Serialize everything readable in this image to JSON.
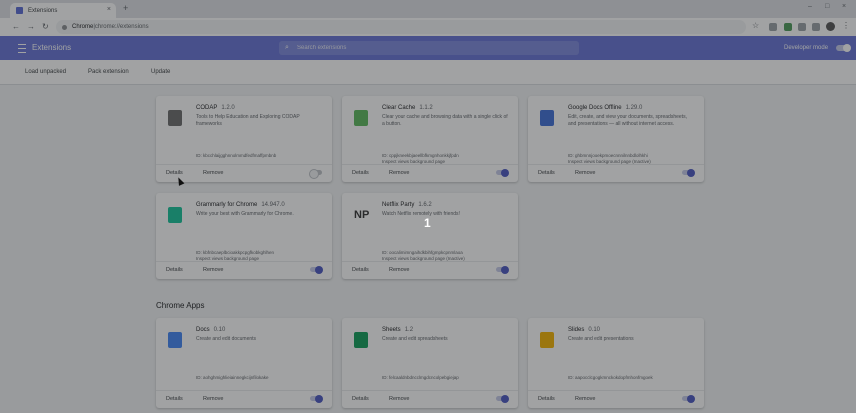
{
  "browser": {
    "tab_title": "Extensions",
    "tab_close": "×",
    "new_tab": "+",
    "window_controls": [
      "–",
      "□",
      "×"
    ],
    "address_chip": "Chrome",
    "address_sep": " | ",
    "address_url": "chrome://extensions"
  },
  "header": {
    "title": "Extensions",
    "search_placeholder": "Search extensions",
    "dev_mode_label": "Developer mode"
  },
  "subbar": {
    "load_unpacked": "Load unpacked",
    "pack_extension": "Pack extension",
    "update": "Update"
  },
  "extensions": [
    {
      "name": "CODAP",
      "version": "1.2.0",
      "description": "Tools to Help Education and Exploring CODAP frameworks",
      "id": "ID: kbcchlaijgghnnolmmdfedfmaffpmbnb",
      "details": "Details",
      "remove": "Remove",
      "enabled": false,
      "icon_color": "#6b6b6b"
    },
    {
      "name": "Clear Cache",
      "version": "1.1.2",
      "description": "Clear your cache and browsing data with a single click of a button.",
      "id": "ID: cppjkneekbjaeellbfkmgnhonkkjfpdn",
      "inspect": "Inspect views background page",
      "details": "Details",
      "remove": "Remove",
      "enabled": true,
      "icon_color": "#5cb85c"
    },
    {
      "name": "Google Docs Offline",
      "version": "1.29.0",
      "description": "Edit, create, and view your documents, spreadsheets, and presentations — all without internet access.",
      "id": "ID: ghbmnnjooekpmoecnnnilnnbdlolhkhi",
      "inspect": "Inspect views background page (Inactive)",
      "details": "Details",
      "remove": "Remove",
      "enabled": true,
      "icon_color": "#3f6ed8"
    },
    {
      "name": "Grammarly for Chrome",
      "version": "14.947.0",
      "description": "Write your best with Grammarly for Chrome.",
      "id": "ID: kbfnbcaeplbcioakkpcpgfkobkghlhen",
      "inspect": "Inspect views background page",
      "details": "Details",
      "remove": "Remove",
      "enabled": true,
      "icon_color": "#15c39a"
    },
    {
      "name": "Netflix Party",
      "version": "1.6.2",
      "description": "Watch Netflix remotely with friends!",
      "id": "ID: oocalimimngaihdkbihfgmpkcpnmlaoa",
      "inspect": "Inspect views background page (Inactive)",
      "details": "Details",
      "remove": "Remove",
      "enabled": true,
      "icon_color": "#333333",
      "icon_text": "NP"
    }
  ],
  "apps_section_title": "Chrome Apps",
  "apps": [
    {
      "name": "Docs",
      "version": "0.10",
      "description": "Create and edit documents",
      "id": "ID: aohghmighlieiainnegkcijnfilokake",
      "details": "Details",
      "remove": "Remove",
      "enabled": true,
      "icon_color": "#4285f4"
    },
    {
      "name": "Sheets",
      "version": "1.2",
      "description": "Create and edit spreadsheets",
      "id": "ID: felcaaldnbdncclmgdcncolpebgiejap",
      "details": "Details",
      "remove": "Remove",
      "enabled": true,
      "icon_color": "#0f9d58"
    },
    {
      "name": "Slides",
      "version": "0.10",
      "description": "Create and edit presentations",
      "id": "ID: aapocclcgogkmnckokdopfmhonfmgoek",
      "details": "Details",
      "remove": "Remove",
      "enabled": true,
      "icon_color": "#f4b400"
    }
  ],
  "overlay_number": "1",
  "colors": {
    "accent": "#6673d6",
    "toggle_on": "#4a56c2"
  }
}
